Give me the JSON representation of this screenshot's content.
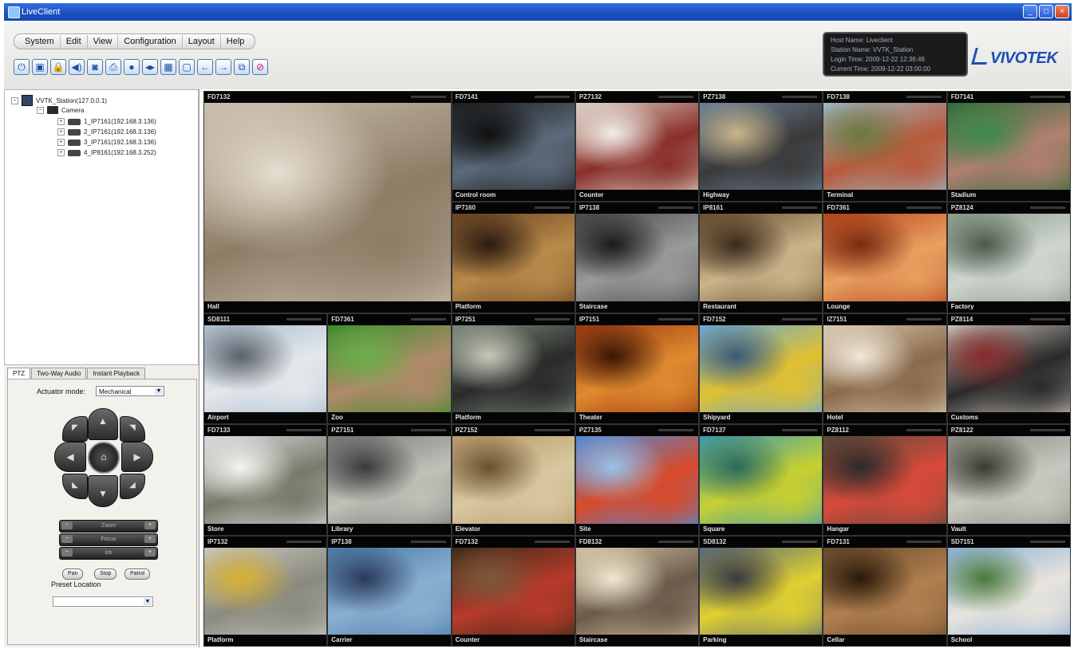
{
  "window": {
    "title": "LiveClient",
    "buttons": [
      "_",
      "□",
      "×"
    ]
  },
  "menu": [
    "System",
    "Edit",
    "View",
    "Configuration",
    "Layout",
    "Help"
  ],
  "toolbar_icons": [
    "power-icon",
    "layout-icon",
    "lock-icon",
    "speaker-icon",
    "snapshot-icon",
    "print-icon",
    "record-icon",
    "stream-icon",
    "grid-icon",
    "fullscreen-icon",
    "back-arrow-icon",
    "forward-arrow-icon",
    "playback-icon",
    "stop-icon"
  ],
  "toolbar_glyphs": [
    "⏻",
    "▣",
    "🔒",
    "◀)",
    "◙",
    "⎙",
    "●",
    "◂▸",
    "▦",
    "▢",
    "←",
    "→",
    "⧉",
    "⊘"
  ],
  "status": {
    "lines": [
      "Host Name: Liveclient",
      "Station Name: VVTK_Station",
      "Login Time: 2009-12-22 12:36:48",
      "Current Time: 2009-12-22 03:00:00"
    ]
  },
  "brand": {
    "logo_text": "VIVOTEK",
    "color": "#1c4fb5"
  },
  "tree": {
    "root": "VVTK_Station(127.0.0.1)",
    "folder": "Camera",
    "cameras": [
      "1_IP7161(192.168.3.136)",
      "2_IP7161(192.168.3.136)",
      "3_IP7161(192.168.3.136)",
      "4_IP8161(192.168.3.252)"
    ]
  },
  "ptz_panel": {
    "tabs": [
      "PTZ",
      "Two-Way Audio",
      "Instant Playback"
    ],
    "active_tab": "PTZ",
    "mode_label": "Actuator mode:",
    "mode_value": "Mechanical",
    "zoom_label": "Zoom",
    "focus_label": "Focus",
    "iris_label": "Iris",
    "buttons": [
      "Pan",
      "Stop",
      "Patrol"
    ],
    "preset_label": "Preset Location",
    "preset_value": ""
  },
  "video_grid": {
    "cells": [
      {
        "id": "FD7132",
        "label": "Hall",
        "col": 0,
        "row": 0,
        "w": 2,
        "h": 2,
        "palette": [
          "#cbbfae",
          "#8c7d66",
          "#e6ddd0"
        ]
      },
      {
        "id": "FD7141",
        "label": "Control room",
        "col": 2,
        "row": 0,
        "w": 1,
        "h": 1,
        "palette": [
          "#1d1d1d",
          "#5b6a7a",
          "#0f0f0f"
        ]
      },
      {
        "id": "PZ7132",
        "label": "Counter",
        "col": 3,
        "row": 0,
        "w": 1,
        "h": 1,
        "palette": [
          "#d8d0c4",
          "#8a2f2a",
          "#f2ede6"
        ]
      },
      {
        "id": "PZ7138",
        "label": "Highway",
        "col": 4,
        "row": 0,
        "w": 1,
        "h": 1,
        "palette": [
          "#6a7f95",
          "#3a3a3a",
          "#c9b58a"
        ]
      },
      {
        "id": "FD7138",
        "label": "Terminal",
        "col": 5,
        "row": 0,
        "w": 1,
        "h": 1,
        "palette": [
          "#9cb8c9",
          "#b85a3a",
          "#6a7a3f"
        ]
      },
      {
        "id": "FD7141",
        "label": "Stadium",
        "col": 6,
        "row": 0,
        "w": 1,
        "h": 1,
        "palette": [
          "#2f6a3a",
          "#b08070",
          "#3b8a4a"
        ]
      },
      {
        "id": "IP7160",
        "label": "Platform",
        "col": 2,
        "row": 1,
        "w": 1,
        "h": 1,
        "palette": [
          "#6a4422",
          "#b98a4a",
          "#2a1a10"
        ]
      },
      {
        "id": "IP7138",
        "label": "Staircase",
        "col": 3,
        "row": 1,
        "w": 1,
        "h": 1,
        "palette": [
          "#4a4a4a",
          "#9a9a9a",
          "#1a1a1a"
        ]
      },
      {
        "id": "IP8161",
        "label": "Restaurant",
        "col": 4,
        "row": 1,
        "w": 1,
        "h": 1,
        "palette": [
          "#6a5030",
          "#cbb38a",
          "#3a2a1a"
        ]
      },
      {
        "id": "FD7361",
        "label": "Lounge",
        "col": 5,
        "row": 1,
        "w": 1,
        "h": 1,
        "palette": [
          "#b8441a",
          "#e8a060",
          "#7a2a10"
        ]
      },
      {
        "id": "PZ8124",
        "label": "Factory",
        "col": 6,
        "row": 1,
        "w": 1,
        "h": 1,
        "palette": [
          "#8a9a8a",
          "#cfd6d0",
          "#4a5a4a"
        ]
      },
      {
        "id": "SD8111",
        "label": "Airport",
        "col": 0,
        "row": 2,
        "w": 1,
        "h": 1,
        "palette": [
          "#aabccc",
          "#e4e8ec",
          "#5a6068"
        ]
      },
      {
        "id": "FD7361",
        "label": "Zoo",
        "col": 1,
        "row": 2,
        "w": 1,
        "h": 1,
        "palette": [
          "#3a8a2a",
          "#b08a6a",
          "#6ab04a"
        ]
      },
      {
        "id": "IP7251",
        "label": "Platform",
        "col": 2,
        "row": 2,
        "w": 1,
        "h": 1,
        "palette": [
          "#7a8a7a",
          "#2a2a2a",
          "#c8c8b8"
        ]
      },
      {
        "id": "IP7151",
        "label": "Theater",
        "col": 3,
        "row": 2,
        "w": 1,
        "h": 1,
        "palette": [
          "#9a3a10",
          "#e08a30",
          "#3a1505"
        ]
      },
      {
        "id": "FD7152",
        "label": "Shipyard",
        "col": 4,
        "row": 2,
        "w": 1,
        "h": 1,
        "palette": [
          "#6aa8d8",
          "#e0c030",
          "#3a5a7a"
        ]
      },
      {
        "id": "IZ7151",
        "label": "Hotel",
        "col": 5,
        "row": 2,
        "w": 1,
        "h": 1,
        "palette": [
          "#d8c8b0",
          "#8a6a4a",
          "#f0e8da"
        ]
      },
      {
        "id": "PZ8114",
        "label": "Customs",
        "col": 6,
        "row": 2,
        "w": 1,
        "h": 1,
        "palette": [
          "#c8c0b8",
          "#2a2a2a",
          "#8a2a2a"
        ]
      },
      {
        "id": "FD7133",
        "label": "Store",
        "col": 0,
        "row": 3,
        "w": 1,
        "h": 1,
        "palette": [
          "#d8dce0",
          "#7a7a6a",
          "#f4f4f0"
        ]
      },
      {
        "id": "PZ7151",
        "label": "Library",
        "col": 1,
        "row": 3,
        "w": 1,
        "h": 1,
        "palette": [
          "#7a7a7a",
          "#c0c0b8",
          "#3a3a3a"
        ]
      },
      {
        "id": "PZ7152",
        "label": "Elevator",
        "col": 2,
        "row": 3,
        "w": 1,
        "h": 1,
        "palette": [
          "#b89a6a",
          "#d8c8a0",
          "#6a5030"
        ]
      },
      {
        "id": "PZ7135",
        "label": "Site",
        "col": 3,
        "row": 3,
        "w": 1,
        "h": 1,
        "palette": [
          "#4a8ad8",
          "#d84a2a",
          "#9ac0e8"
        ]
      },
      {
        "id": "FD7137",
        "label": "Square",
        "col": 4,
        "row": 3,
        "w": 1,
        "h": 1,
        "palette": [
          "#3a9ab0",
          "#c8d030",
          "#2a6a5a"
        ]
      },
      {
        "id": "PZ8112",
        "label": "Hangar",
        "col": 5,
        "row": 3,
        "w": 1,
        "h": 1,
        "palette": [
          "#5a4a3a",
          "#d84a3a",
          "#2a2a2a"
        ]
      },
      {
        "id": "PZ8122",
        "label": "Vault",
        "col": 6,
        "row": 3,
        "w": 1,
        "h": 1,
        "palette": [
          "#8a8a80",
          "#c8c8c0",
          "#3a3a30"
        ]
      },
      {
        "id": "IP7132",
        "label": "Platform",
        "col": 0,
        "row": 4,
        "w": 1,
        "h": 1,
        "palette": [
          "#c8c8c0",
          "#8a8a80",
          "#d8b030"
        ]
      },
      {
        "id": "IP7138",
        "label": "Carrier",
        "col": 1,
        "row": 4,
        "w": 1,
        "h": 1,
        "palette": [
          "#4a7aa8",
          "#8ab0d0",
          "#2a3a5a"
        ]
      },
      {
        "id": "FD7132",
        "label": "Counter",
        "col": 2,
        "row": 4,
        "w": 1,
        "h": 1,
        "palette": [
          "#3a2a1a",
          "#b83a2a",
          "#7a5a3a"
        ]
      },
      {
        "id": "FD8132",
        "label": "Staircase",
        "col": 3,
        "row": 4,
        "w": 1,
        "h": 1,
        "palette": [
          "#d0c0a0",
          "#6a5a4a",
          "#f0e8d0"
        ]
      },
      {
        "id": "SD8132",
        "label": "Parking",
        "col": 4,
        "row": 4,
        "w": 1,
        "h": 1,
        "palette": [
          "#5a6a7a",
          "#e0d030",
          "#3a3a40"
        ]
      },
      {
        "id": "FD7131",
        "label": "Cellar",
        "col": 5,
        "row": 4,
        "w": 1,
        "h": 1,
        "palette": [
          "#6a4a2a",
          "#b08050",
          "#2a1a0a"
        ]
      },
      {
        "id": "SD7151",
        "label": "School",
        "col": 6,
        "row": 4,
        "w": 1,
        "h": 1,
        "palette": [
          "#8ab0d8",
          "#e8e4dc",
          "#4a7a3a"
        ]
      }
    ]
  }
}
